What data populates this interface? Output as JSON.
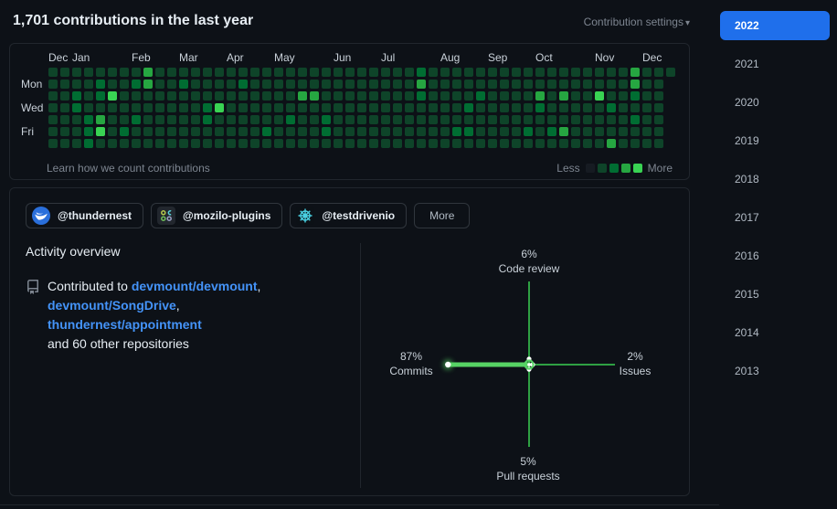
{
  "header": {
    "title": "1,701 contributions in the last year",
    "settings_label": "Contribution settings",
    "settings_caret": "▾"
  },
  "calendar": {
    "months": [
      [
        "Dec",
        0
      ],
      [
        "Jan",
        2
      ],
      [
        "Feb",
        7
      ],
      [
        "Mar",
        11
      ],
      [
        "Apr",
        15
      ],
      [
        "May",
        19
      ],
      [
        "Jun",
        24
      ],
      [
        "Jul",
        28
      ],
      [
        "Aug",
        33
      ],
      [
        "Sep",
        37
      ],
      [
        "Oct",
        41
      ],
      [
        "Nov",
        46
      ],
      [
        "Dec",
        50
      ]
    ],
    "day_labels": [
      [
        "Mon",
        1
      ],
      [
        "Wed",
        3
      ],
      [
        "Fri",
        5
      ]
    ],
    "weeks": [
      "1111111",
      "1111111",
      "1122111",
      "1111222",
      "1221341",
      "1141111",
      "1111121",
      "1211211",
      "3311111",
      "1111111",
      "1111111",
      "1211111",
      "1111111",
      "1112211",
      "1114111",
      "1111111",
      "1211111",
      "1111111",
      "1111121",
      "1111111",
      "1111211",
      "1131111",
      "1131111",
      "1111221",
      "1111111",
      "1111111",
      "1111111",
      "1111111",
      "1111111",
      "1111111",
      "1111111",
      "2321111",
      "1111111",
      "1111111",
      "1111121",
      "1112121",
      "1121111",
      "1111111",
      "1111111",
      "1111111",
      "1111121",
      "1132111",
      "1111121",
      "1131131",
      "1111111",
      "1111111",
      "1141111",
      "1112113",
      "1111111",
      "3321211",
      "1111111",
      "1111111",
      "1000000"
    ],
    "level_colors": [
      "#161b22",
      "#0e4429",
      "#006d32",
      "#26a641",
      "#39d353"
    ],
    "footer": {
      "learn_link": "Learn how we count contributions",
      "less": "Less",
      "more": "More"
    }
  },
  "orgs": {
    "buttons": [
      {
        "label": "@thundernest",
        "avatar": "thunderbird"
      },
      {
        "label": "@mozilo-plugins",
        "avatar": "plugins"
      },
      {
        "label": "@testdrivenio",
        "avatar": "wheel"
      }
    ],
    "more_label": "More"
  },
  "activity": {
    "heading": "Activity overview",
    "contributed_prefix": "Contributed to",
    "repos": [
      "devmount/devmount",
      "devmount/SongDrive",
      "thundernest/appointment"
    ],
    "suffix": "and 60 other repositories"
  },
  "chart_data": {
    "type": "axis-compass",
    "categories": [
      "Code review",
      "Issues",
      "Pull requests",
      "Commits"
    ],
    "values": [
      6,
      2,
      5,
      87
    ],
    "unit": "%",
    "labels": {
      "up": {
        "pct": "6%",
        "name": "Code review"
      },
      "right": {
        "pct": "2%",
        "name": "Issues"
      },
      "down": {
        "pct": "5%",
        "name": "Pull requests"
      },
      "left": {
        "pct": "87%",
        "name": "Commits"
      }
    }
  },
  "years": {
    "active": "2022",
    "items": [
      "2022",
      "2021",
      "2020",
      "2019",
      "2018",
      "2017",
      "2016",
      "2015",
      "2014",
      "2013"
    ]
  },
  "colors": {
    "accent_blue": "#1f6feb",
    "link_blue": "#4493f8",
    "axis_green": "#2ea043",
    "bright_green": "#56d364",
    "bg": "#0d1117",
    "border": "#21262d",
    "muted": "#7d8590"
  }
}
